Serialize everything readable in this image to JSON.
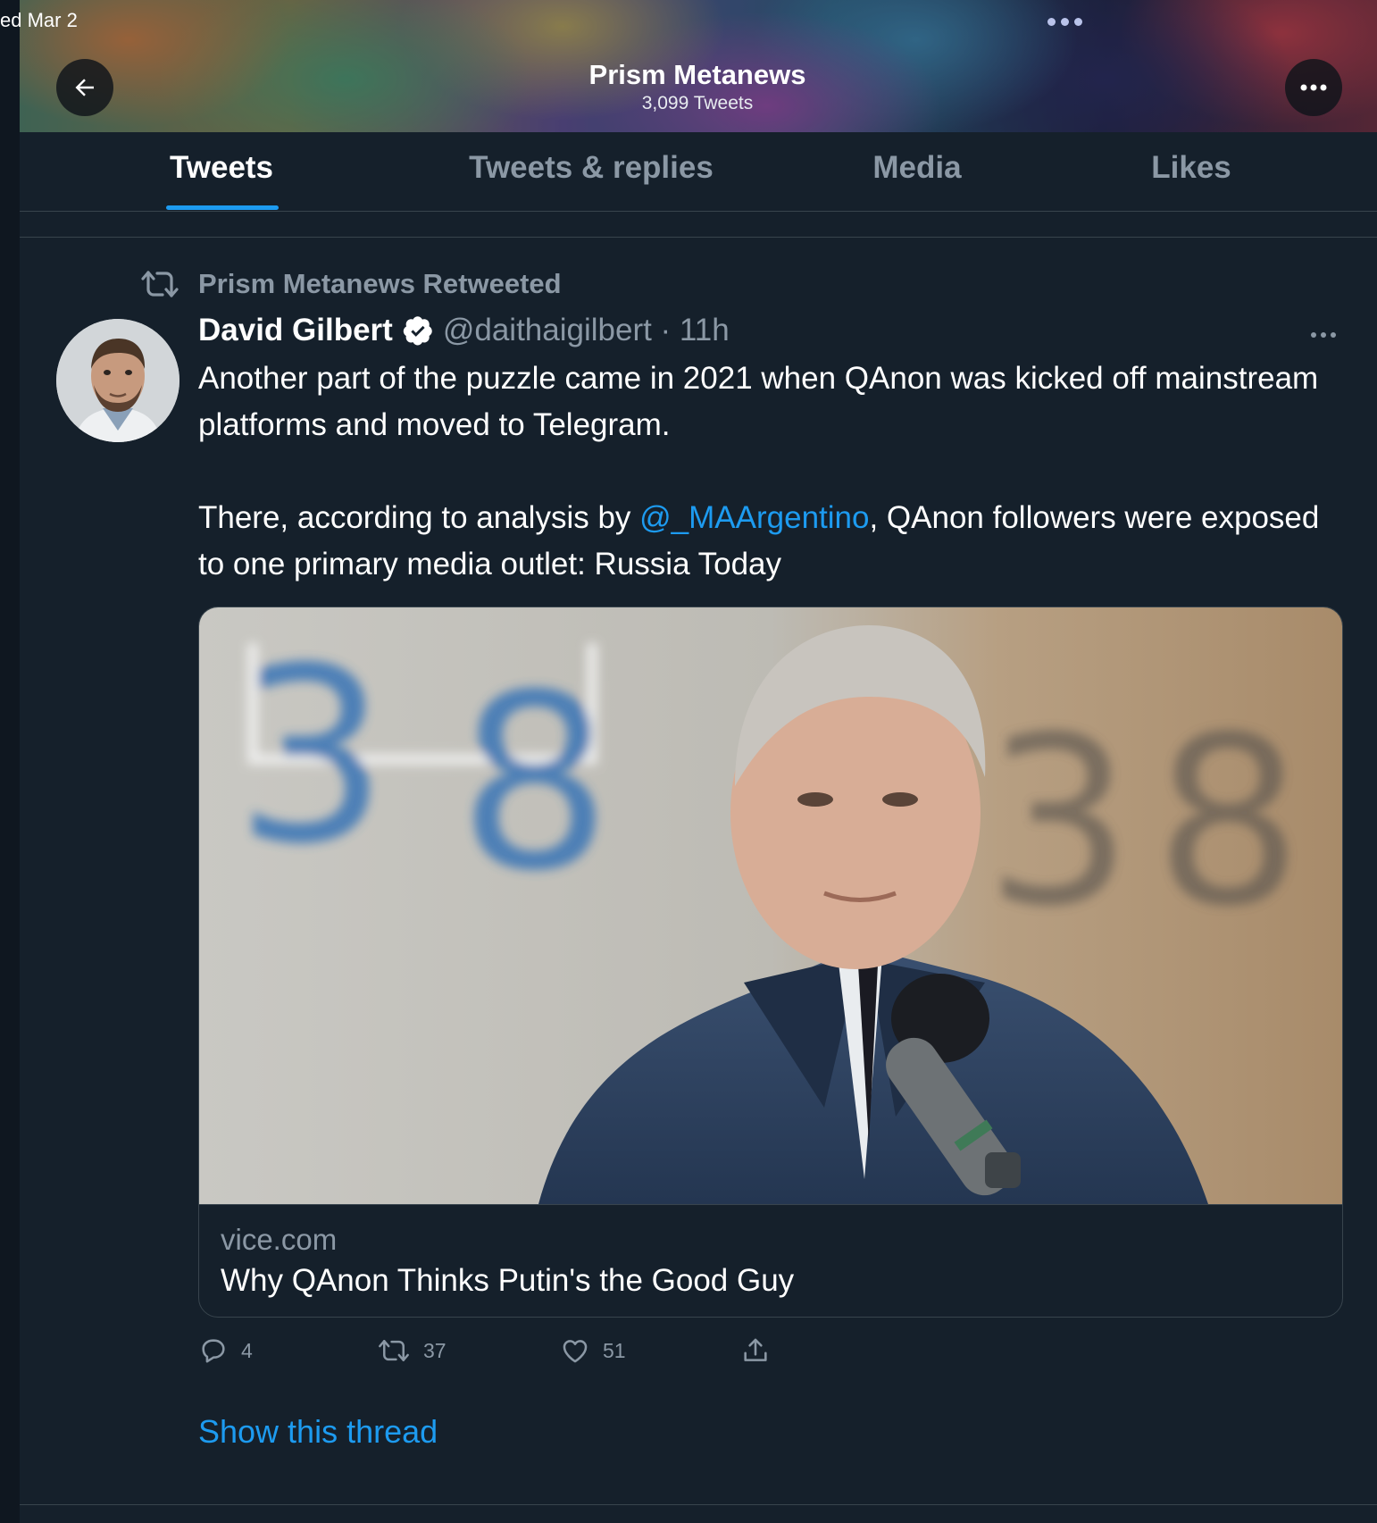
{
  "status_bar": {
    "date": "ed Mar 2"
  },
  "header": {
    "title": "Prism Metanews",
    "subtitle": "3,099 Tweets"
  },
  "tabs": [
    {
      "label": "Tweets",
      "active": true
    },
    {
      "label": "Tweets & replies",
      "active": false
    },
    {
      "label": "Media",
      "active": false
    },
    {
      "label": "Likes",
      "active": false
    }
  ],
  "tweet": {
    "retweeted_by": "Prism Metanews Retweeted",
    "author_name": "David Gilbert",
    "author_handle_time": "@daithaigilbert · 11h",
    "text_p1": "Another part of the puzzle came in 2021 when QAnon was kicked off mainstream platforms and moved to Telegram.",
    "text_p2_before": "There, according to analysis by ",
    "text_p2_mention": "@_MAArgentino",
    "text_p2_after": ", QAnon followers were exposed to one primary media outlet: Russia Today",
    "card": {
      "domain": "vice.com",
      "title": "Why QAnon Thinks Putin's the Good Guy"
    },
    "counts": {
      "replies": "4",
      "retweets": "37",
      "likes": "51"
    },
    "show_thread": "Show this thread"
  },
  "colors": {
    "background": "#15202b",
    "accent": "#1d9bf0",
    "secondary_text": "#8b98a5",
    "border": "#38444d"
  },
  "icons": [
    "back-arrow-icon",
    "more-icon",
    "retweet-icon",
    "verified-badge-icon",
    "reply-icon",
    "like-icon",
    "share-icon"
  ]
}
